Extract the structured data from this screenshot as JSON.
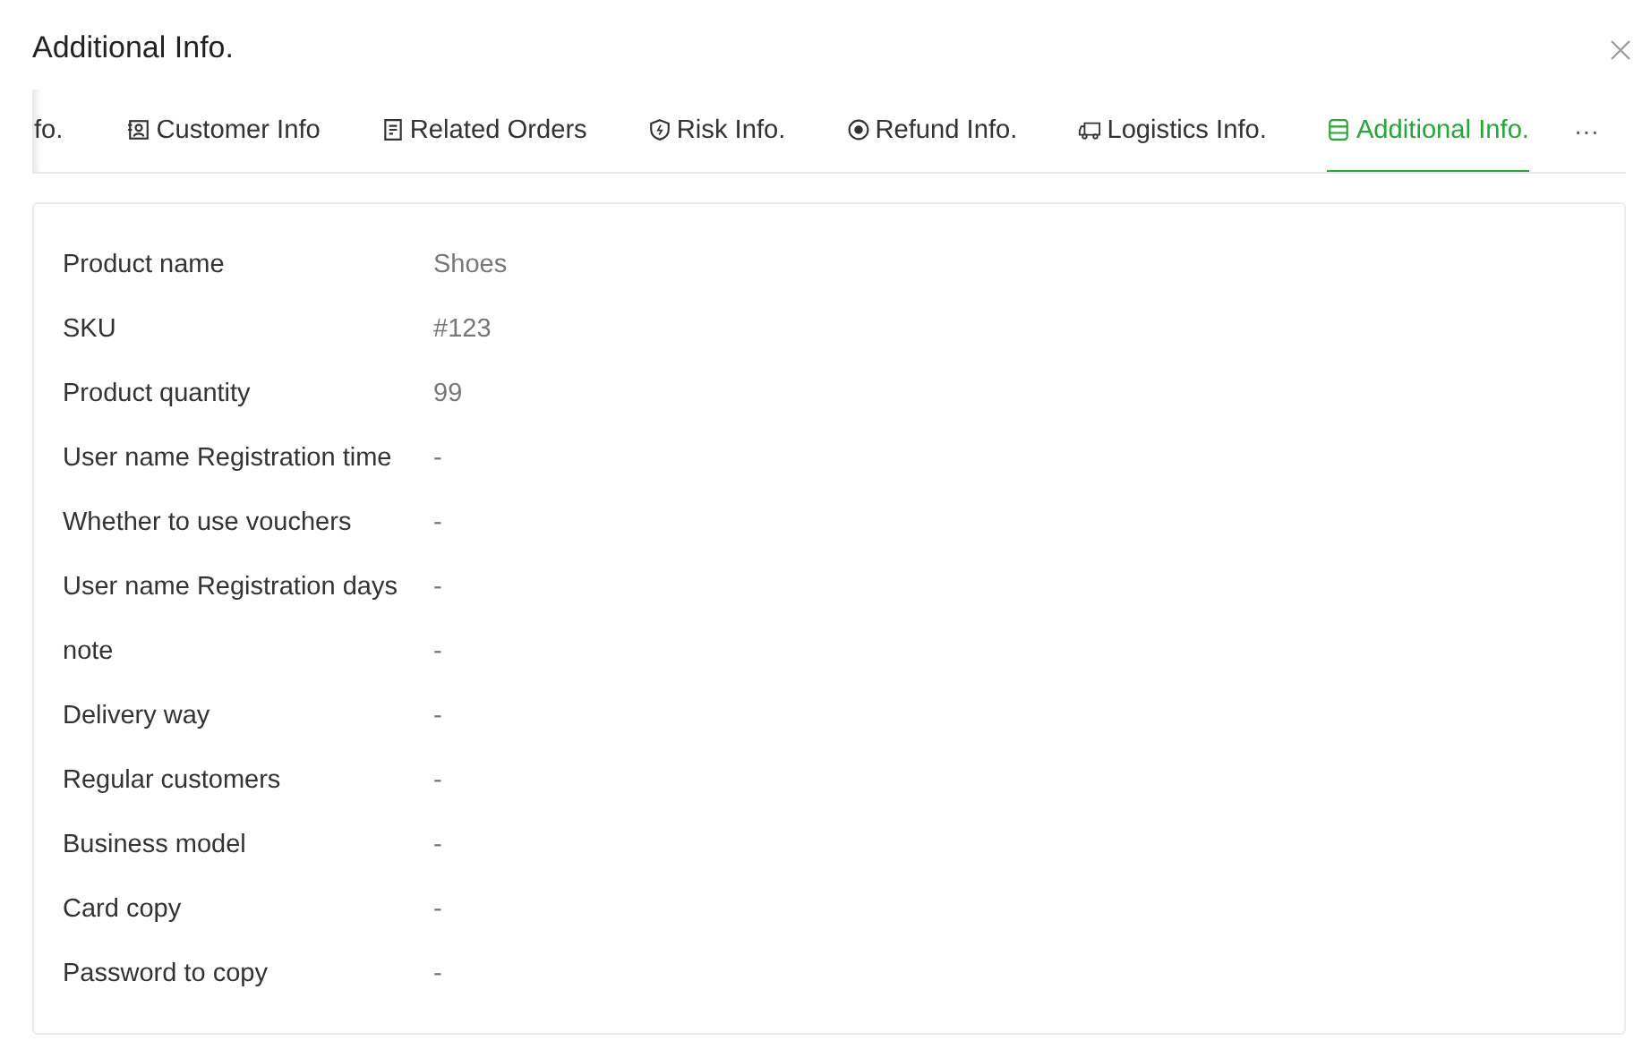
{
  "dialog": {
    "title": "Additional Info."
  },
  "tabs": [
    {
      "label": "fo.",
      "selected": false
    },
    {
      "label": "Customer Info",
      "selected": false
    },
    {
      "label": "Related Orders",
      "selected": false
    },
    {
      "label": "Risk Info.",
      "selected": false
    },
    {
      "label": "Refund Info.",
      "selected": false
    },
    {
      "label": "Logistics Info.",
      "selected": false
    },
    {
      "label": "Additional Info.",
      "selected": true
    }
  ],
  "more_tabs": "···",
  "fields": [
    {
      "label": "Product name",
      "value": "Shoes"
    },
    {
      "label": "SKU",
      "value": "#123"
    },
    {
      "label": "Product quantity",
      "value": "99"
    },
    {
      "label": "User name Registration time",
      "value": "-"
    },
    {
      "label": "Whether to use vouchers",
      "value": "-"
    },
    {
      "label": "User name Registration days",
      "value": "-"
    },
    {
      "label": "note",
      "value": "-"
    },
    {
      "label": "Delivery way",
      "value": "-"
    },
    {
      "label": "Regular customers",
      "value": "-"
    },
    {
      "label": "Business model",
      "value": "-"
    },
    {
      "label": "Card copy",
      "value": "-"
    },
    {
      "label": "Password to copy",
      "value": "-"
    }
  ]
}
